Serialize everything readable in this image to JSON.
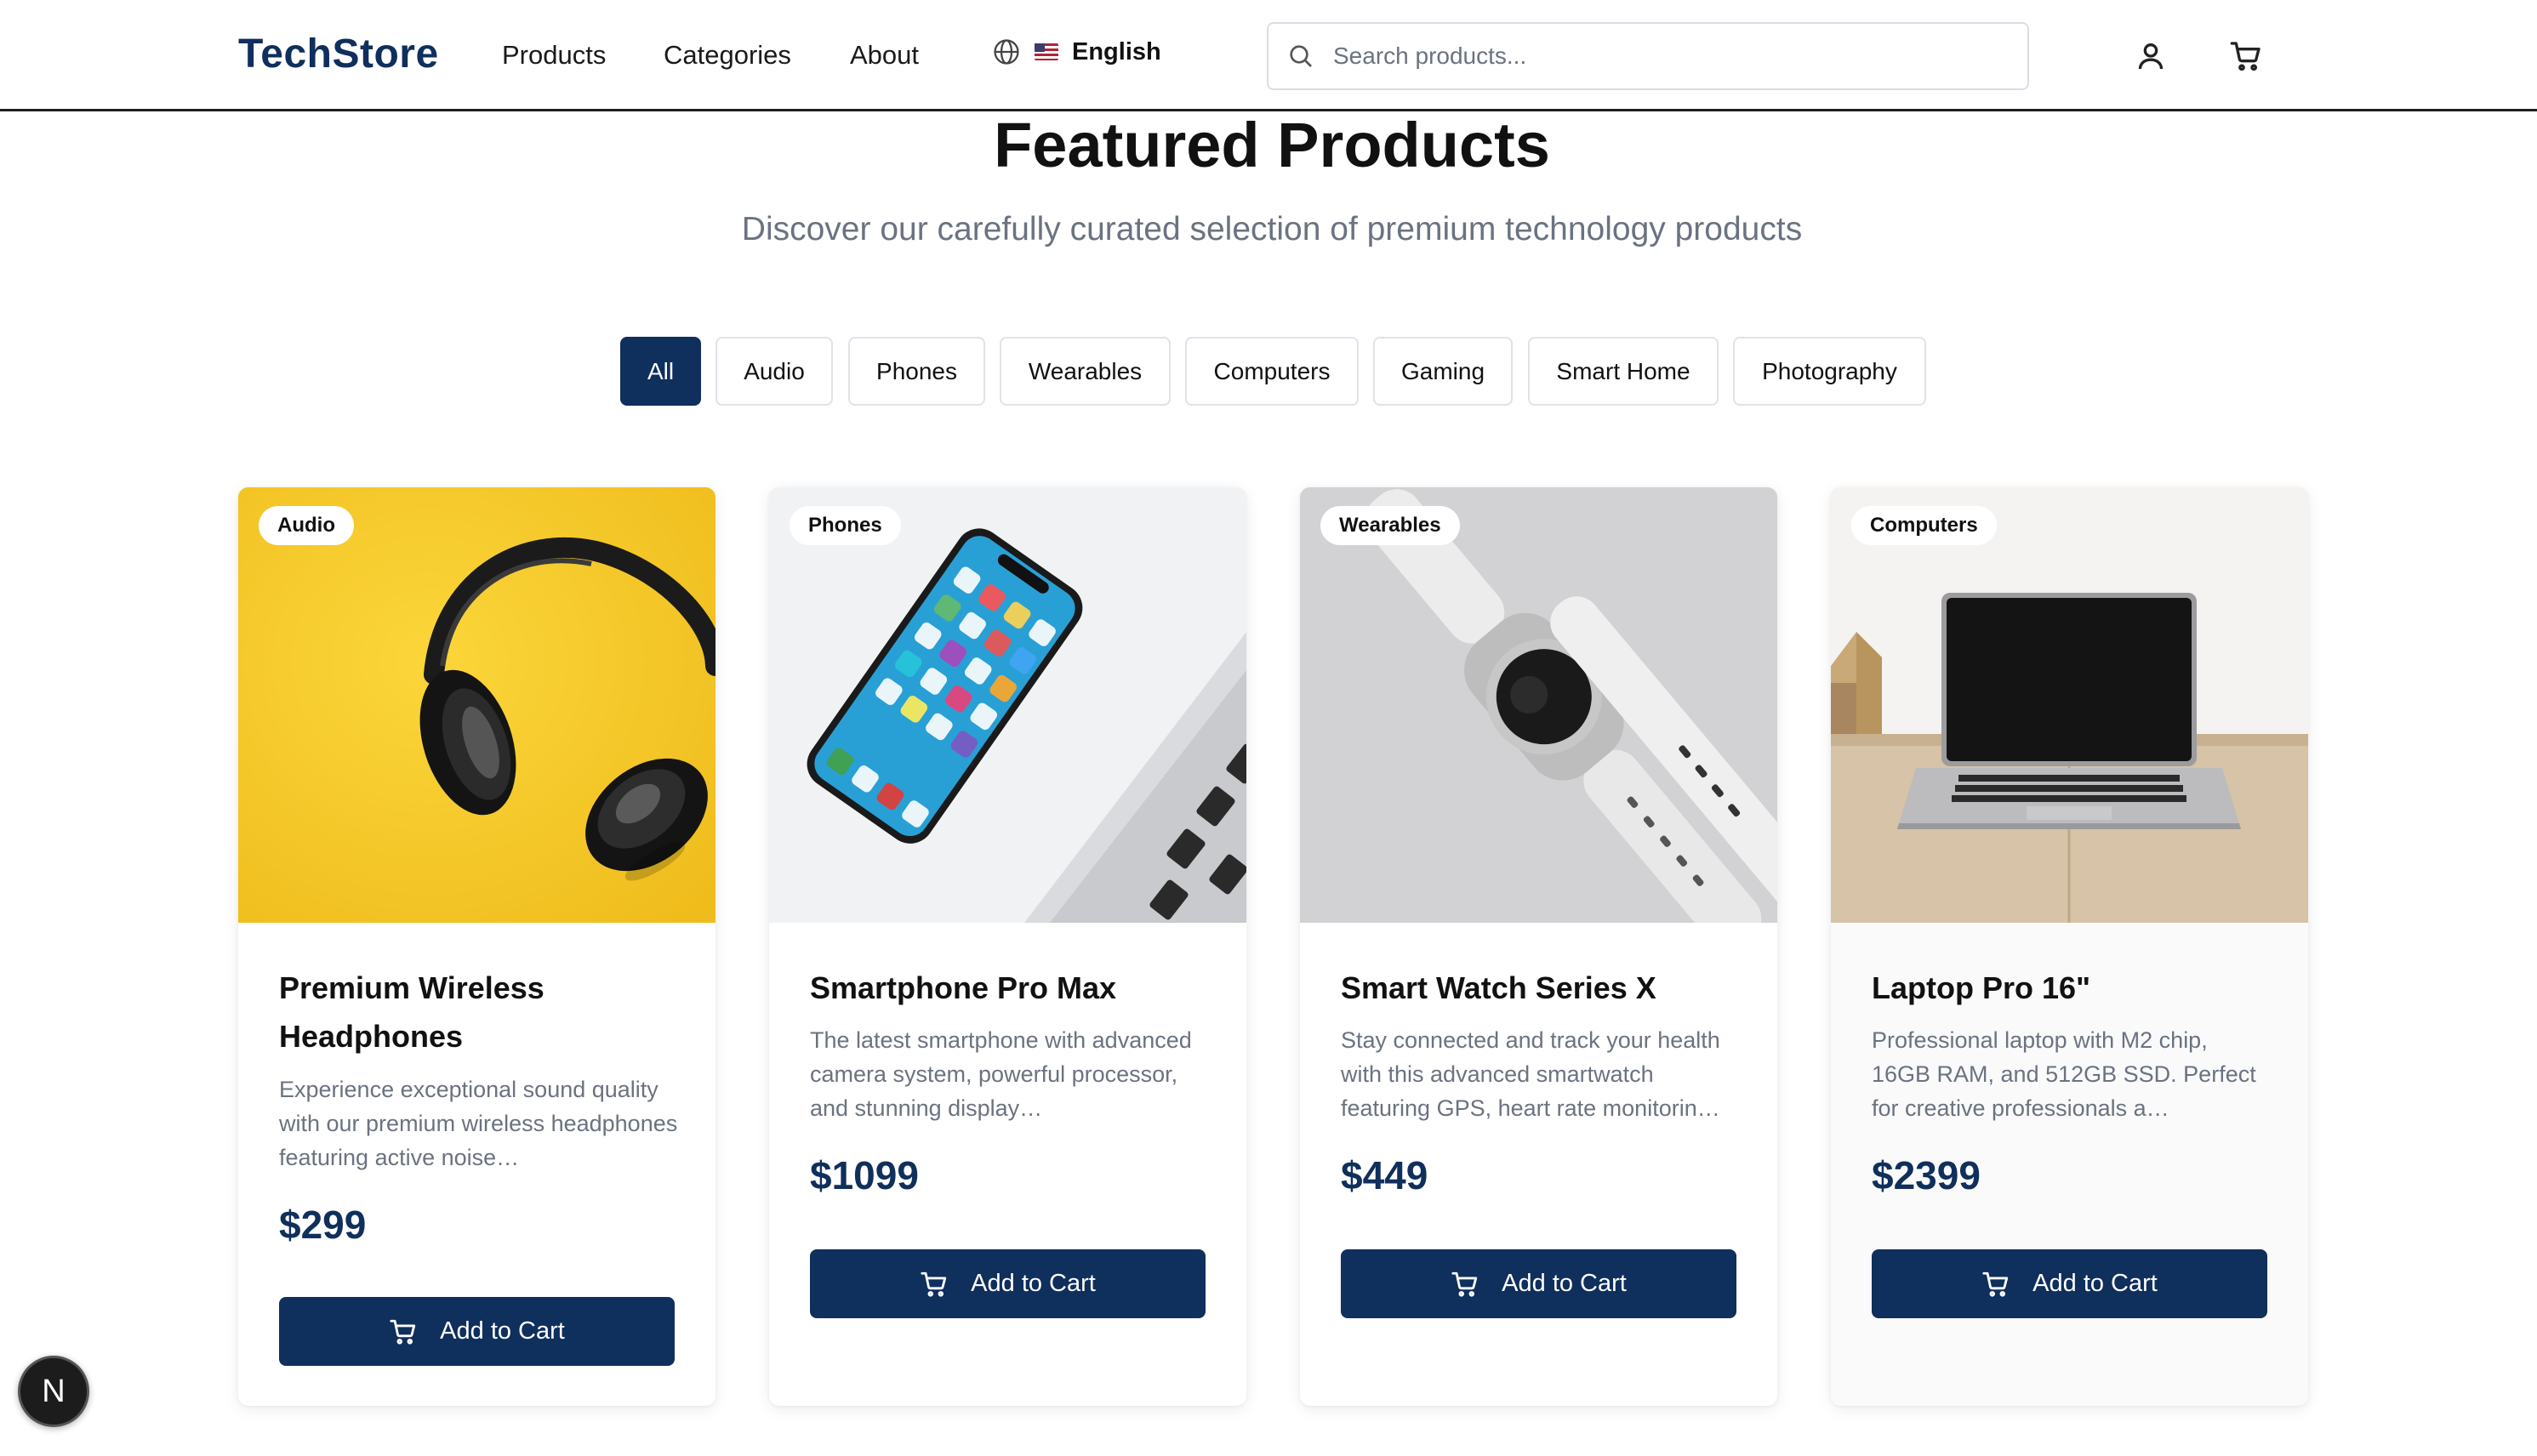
{
  "header": {
    "logo": "TechStore",
    "nav": [
      "Products",
      "Categories",
      "About"
    ],
    "language": "English",
    "search_placeholder": "Search products..."
  },
  "hero": {
    "title": "Featured Products",
    "subtitle": "Discover our carefully curated selection of premium technology products"
  },
  "filters": {
    "active": "All",
    "items": [
      "All",
      "Audio",
      "Phones",
      "Wearables",
      "Computers",
      "Gaming",
      "Smart Home",
      "Photography"
    ]
  },
  "products": [
    {
      "category": "Audio",
      "title": "Premium Wireless Headphones",
      "description": "Experience exceptional sound quality with our premium wireless headphones featuring active noise…",
      "price": "$299",
      "button": "Add to Cart"
    },
    {
      "category": "Phones",
      "title": "Smartphone Pro Max",
      "description": "The latest smartphone with advanced camera system, powerful processor, and stunning display…",
      "price": "$1099",
      "button": "Add to Cart"
    },
    {
      "category": "Wearables",
      "title": "Smart Watch Series X",
      "description": "Stay connected and track your health with this advanced smartwatch featuring GPS, heart rate monitorin…",
      "price": "$449",
      "button": "Add to Cart"
    },
    {
      "category": "Computers",
      "title": "Laptop Pro 16\"",
      "description": "Professional laptop with M2 chip, 16GB RAM, and 512GB SSD. Perfect for creative professionals a…",
      "price": "$2399",
      "button": "Add to Cart"
    }
  ],
  "dev_badge": "N",
  "colors": {
    "brand": "#0f2f5c",
    "muted_text": "#6b7280",
    "border": "#dfe3e8"
  }
}
